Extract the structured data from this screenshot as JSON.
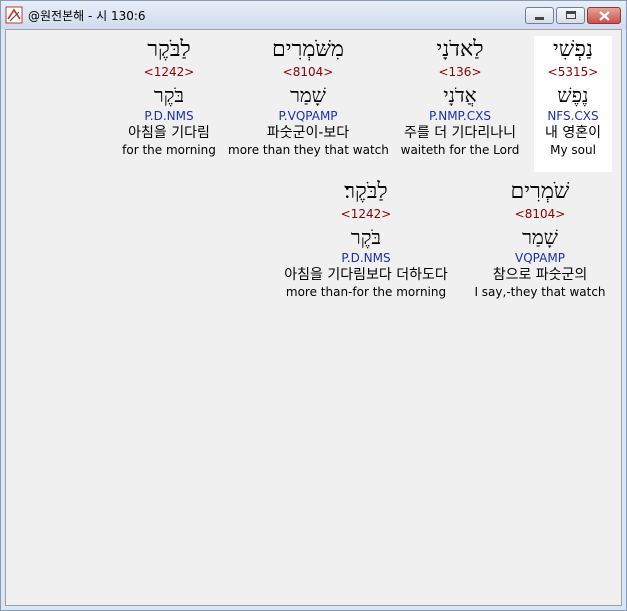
{
  "window": {
    "title": "@원전본해 - 시 130:6",
    "buttons": {
      "minimize": "minimize",
      "maximize": "maximize",
      "close": "close"
    }
  },
  "verse": {
    "row1": [
      {
        "hebrew": "נַפְשִׁי",
        "strong": "<5315>",
        "lemma": "נֶפֶשׁ",
        "parse": "NFS.CXS",
        "korean": "내 영혼이",
        "english": "My soul",
        "selected": true
      },
      {
        "hebrew": "לַאדֹנָי",
        "strong": "<136>",
        "lemma": "אֲדֹנָי",
        "parse": "P.NMP.CXS",
        "korean": "주를 더 기다리나니",
        "english": "waiteth for the Lord",
        "selected": false
      },
      {
        "hebrew": "מִשֹּׁמְרִים",
        "strong": "<8104>",
        "lemma": "שָׁמַר",
        "parse": "P.VQPAMP",
        "korean": "파숫군이-보다",
        "english": "more than they that watch",
        "selected": false
      },
      {
        "hebrew": "לַבֹּקֶר",
        "strong": "<1242>",
        "lemma": "בֹּקֶר",
        "parse": "P.D.NMS",
        "korean": "아침을 기다림",
        "english": "for the morning",
        "selected": false
      }
    ],
    "row2": [
      {
        "hebrew": "שֹׁמְרִים",
        "strong": "<8104>",
        "lemma": "שָׁמַר",
        "parse": "VQPAMP",
        "korean": "참으로 파숫군의",
        "english": "I say,-they that watch",
        "selected": false
      },
      {
        "hebrew": "לַבֹּקֶר׃",
        "strong": "<1242>",
        "lemma": "בֹּקֶר",
        "parse": "P.D.NMS",
        "korean": "아침을 기다림보다 더하도다",
        "english": "more than-for the morning",
        "selected": false
      }
    ]
  }
}
